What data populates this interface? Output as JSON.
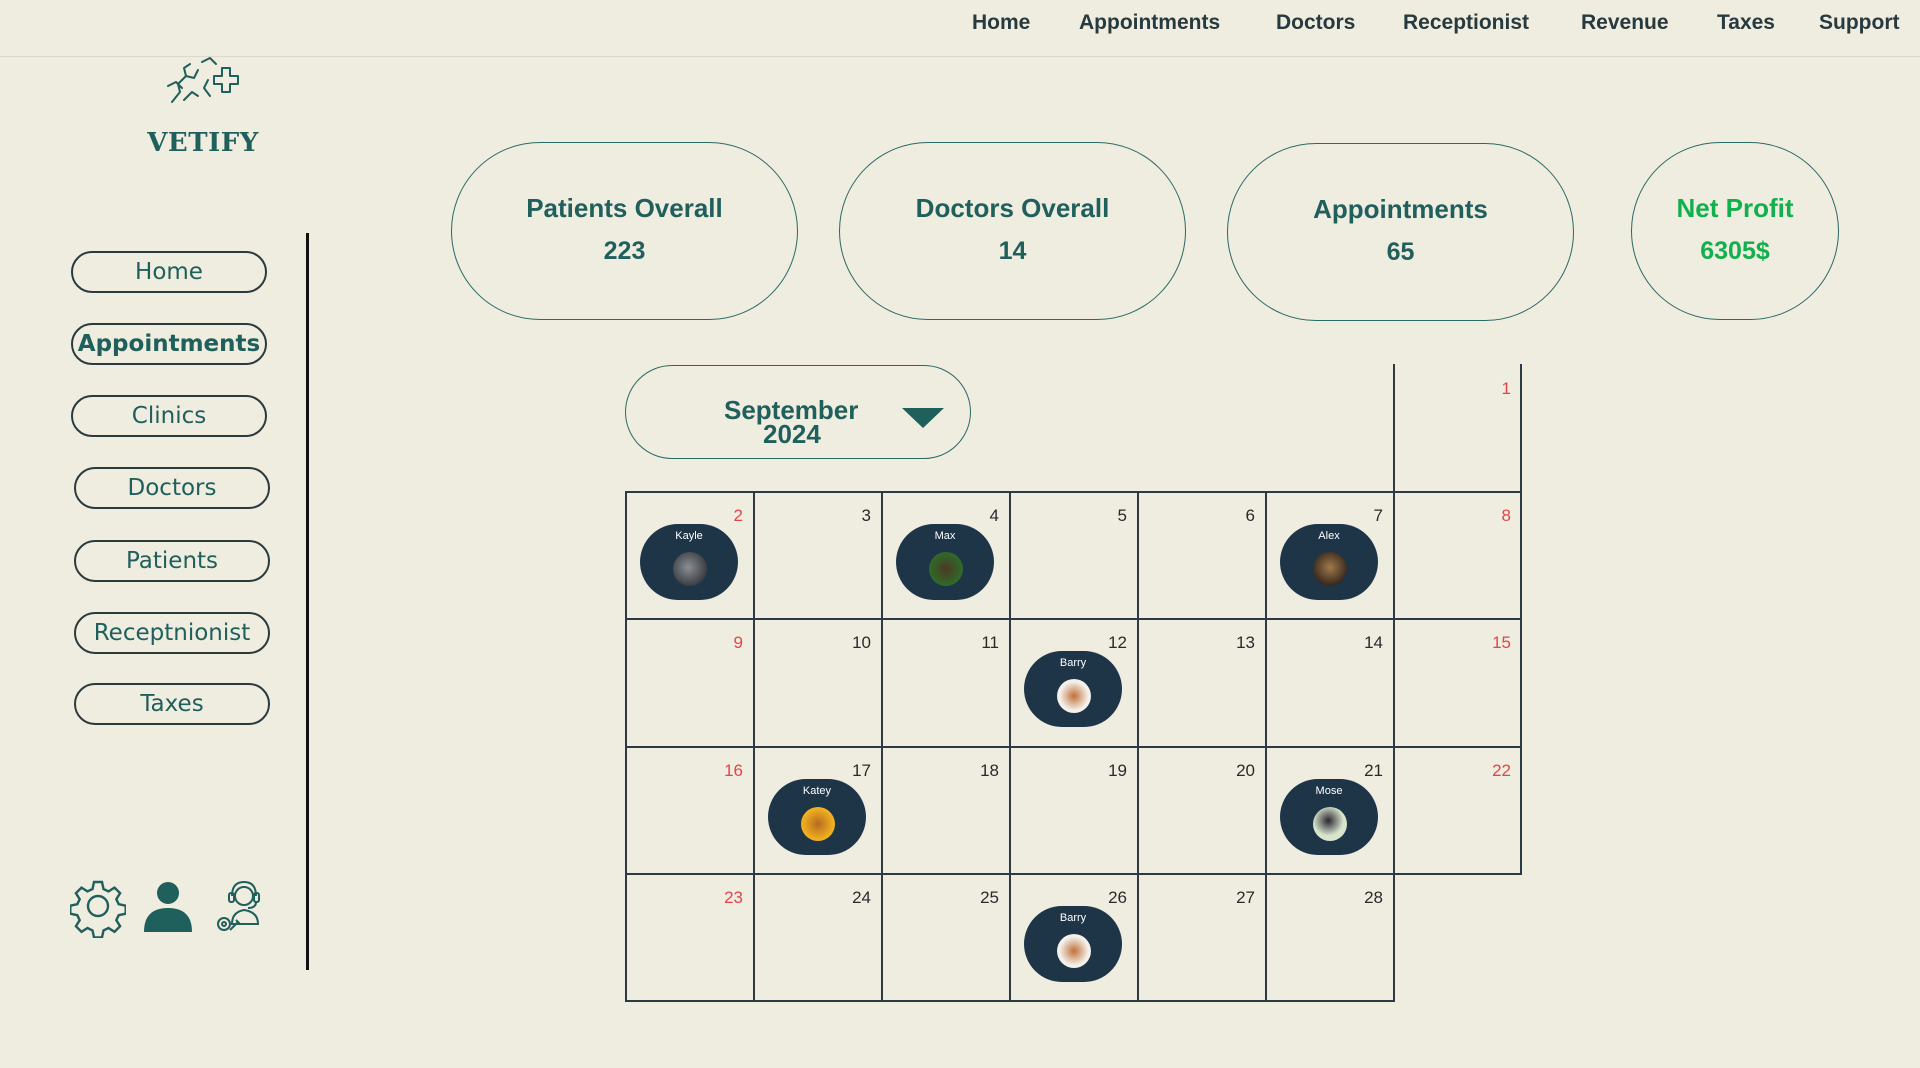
{
  "app": {
    "brand": "VETIFY"
  },
  "topnav": [
    "Home",
    "Appointments",
    "Doctors",
    "Receptionist",
    "Revenue",
    "Taxes",
    "Support"
  ],
  "sidebar": {
    "items": [
      "Home",
      "Appointments",
      "Clinics",
      "Doctors",
      "Patients",
      "Receptnionist",
      "Taxes"
    ],
    "active": "Appointments"
  },
  "stats": [
    {
      "label": "Patients Overall",
      "value": "223"
    },
    {
      "label": "Doctors Overall",
      "value": "14"
    },
    {
      "label": "Appointments",
      "value": "65"
    },
    {
      "label": "Net Profit",
      "value": "6305$"
    }
  ],
  "calendar": {
    "month": "September",
    "year": "2024",
    "days": [
      "1",
      "2",
      "3",
      "4",
      "5",
      "6",
      "7",
      "8",
      "9",
      "10",
      "11",
      "12",
      "13",
      "14",
      "15",
      "16",
      "17",
      "18",
      "19",
      "20",
      "21",
      "22",
      "23",
      "24",
      "25",
      "26",
      "27",
      "28"
    ],
    "appointments": [
      {
        "day": "2",
        "name": "Kayle"
      },
      {
        "day": "4",
        "name": "Max"
      },
      {
        "day": "7",
        "name": "Alex"
      },
      {
        "day": "12",
        "name": "Barry"
      },
      {
        "day": "17",
        "name": "Katey"
      },
      {
        "day": "21",
        "name": "Mose"
      },
      {
        "day": "26",
        "name": "Barry"
      }
    ]
  },
  "colors": {
    "accent": "#1f5f5c",
    "profit": "#12b04c",
    "weekend": "#e0454a",
    "appointment_bg": "#1e3548",
    "background": "#efece0"
  },
  "icons": [
    "settings-gear-icon",
    "user-profile-icon",
    "support-headset-icon"
  ]
}
